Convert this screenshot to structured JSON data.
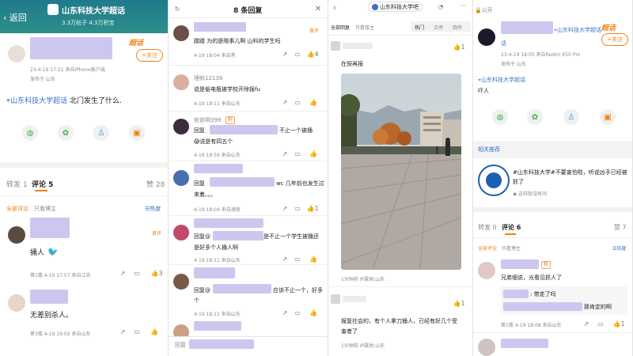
{
  "panel1": {
    "back_label": "返回",
    "topic_name": "山东科技大学超话",
    "topic_stats": "3.3万帖子 4.3万积宝",
    "post_meta_line1": "23-4-19 17:51 来自iPhone客户端",
    "post_meta_line2": "发布于 山东",
    "follow_label": "+关注",
    "badge_label": "超话",
    "post_topic": "山东科技大学超话",
    "post_text": " 北门发生了什么.",
    "tab_repost": "转发 1",
    "tab_comment": "评论 5",
    "tab_like": "赞 28",
    "filter_all": "全部评论",
    "filter_owner": "只看博主",
    "filter_hot": "热度",
    "comments": [
      {
        "text": "捅人",
        "meta": "第1楼 4-19 17:57 来自江苏",
        "likes": "3",
        "first": "首评"
      },
      {
        "text": "无差别杀人。",
        "meta": "第3楼 4-19 19:02 来自山东",
        "likes": ""
      }
    ]
  },
  "panel2": {
    "title": "8 条回复",
    "items": [
      {
        "text": "蹭蹭 为的是陪事儿啊 山科的学生吗",
        "meta": "4-19 18:04 来自黑",
        "likes": "4",
        "first": "首评"
      },
      {
        "name": "理斜12138",
        "text": "说是偷电瓶被学校开除报fu",
        "meta": "4-19 18:11 来自山东"
      },
      {
        "name": "依依啊399",
        "text_pre": "回复",
        "text_post": "不止一个被捅",
        "text2": "说是有四五个",
        "meta": "4-19 18:59 来自山东",
        "emoji": "😱"
      },
      {
        "text_pre": "回复",
        "text_post": "wc 几年前也发生过",
        "text2": "来着。。。",
        "meta": "4-19 18:04 来自湖南",
        "likes": "1"
      },
      {
        "text_pre": "回复@",
        "text_post": "是不止一个学生被捅还",
        "text2": "是好多个人捅人啊",
        "meta": "4-19 18:11 来自山东"
      },
      {
        "text_pre": "回复@",
        "text_post": "应该不止一个，好多",
        "text2": "个",
        "meta": "4-19 18:11 来自山东"
      }
    ],
    "reply_placeholder": "回复"
  },
  "panel3": {
    "topic_chip": "山东科技大学吧",
    "tabs": [
      "热门",
      "正序",
      "倒序"
    ],
    "filter_all": "全部回复",
    "filter_owner": "只看楼主",
    "comment1": "在探再报",
    "meta1": "1分钟前 IP属地:山东",
    "likes1": "1",
    "comment2": "报复社会的，有个人拿刀捅人，已经有好几个受害者了",
    "meta2": "1分钟前 IP属地:山东",
    "likes2": "1"
  },
  "panel4": {
    "public_label": "公开",
    "topic_name": "山东科技大学超话",
    "badge_label": "超话",
    "follow_label": "+关注",
    "meta_line1": "23-4-19 18:05 来自Redmi K50 Pro",
    "meta_line2": "发布于 山东",
    "post_topic": "山东科技大学超话",
    "post_text": "吓人",
    "related_label": "相关推荐",
    "rec_title": "#山东科技大学#不要害怕啦，听说凶手已经被抓了",
    "rec_sub": "这样就没有问",
    "tab_repost": "转发 0",
    "tab_comment": "评论 6",
    "tab_like": "赞 7",
    "filter_all": "全部评论",
    "filter_owner": "只看博主",
    "filter_hot": "热度",
    "comment_text": "兄弟细说，光看见抓人了",
    "reply1": "带走了吗",
    "reply2": "那肯定的啊",
    "comment_meta": "第1楼 4-19 18:08 来自山东",
    "likes": "1"
  }
}
